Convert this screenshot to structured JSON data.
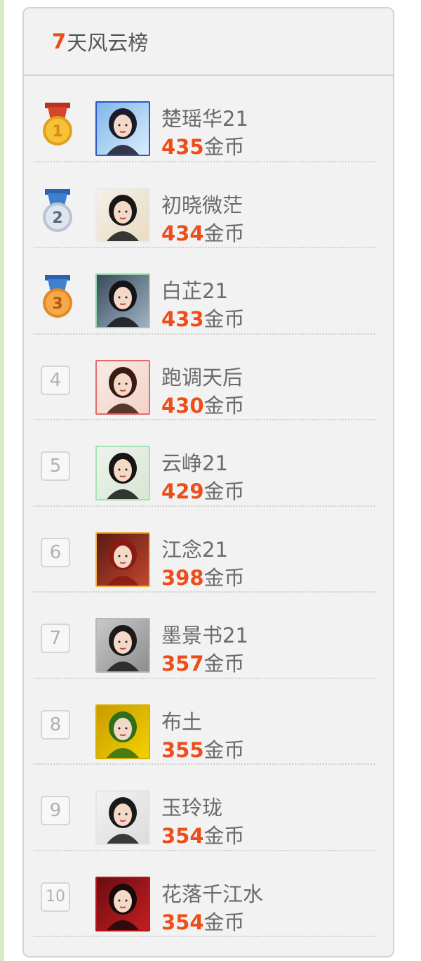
{
  "board": {
    "title_num": "7",
    "title_text": "天风云榜",
    "currency": "金币"
  },
  "ranking": [
    {
      "rank": "1",
      "name": "楚瑶华21",
      "score": "435",
      "badge": "gold-medal-icon",
      "frame": "#2a58c8",
      "bg1": "#7fb6e8",
      "bg2": "#d9eefc",
      "hair": "#1b1b2a"
    },
    {
      "rank": "2",
      "name": "初晓微茫",
      "score": "434",
      "badge": "silver-medal-icon",
      "frame": "#eaeaea",
      "bg1": "#f4efe6",
      "bg2": "#e9dcc4",
      "hair": "#171717"
    },
    {
      "rank": "3",
      "name": "白芷21",
      "score": "433",
      "badge": "bronze-medal-icon",
      "frame": "#8fd6a8",
      "bg1": "#3a4a5c",
      "bg2": "#9fb3c4",
      "hair": "#141416"
    },
    {
      "rank": "4",
      "name": "跑调天后",
      "score": "430",
      "badge": "rank-box",
      "frame": "#e56a6a",
      "bg1": "#f8ece6",
      "bg2": "#f3d2c8",
      "hair": "#3a1a12"
    },
    {
      "rank": "5",
      "name": "云峥21",
      "score": "429",
      "badge": "rank-box",
      "frame": "#a4e3b4",
      "bg1": "#eef3ec",
      "bg2": "#d7e6d2",
      "hair": "#151515"
    },
    {
      "rank": "6",
      "name": "江念21",
      "score": "398",
      "badge": "rank-box",
      "frame": "#f0b24a",
      "bg1": "#5a1a12",
      "bg2": "#c14730",
      "hair": "#8a1a12"
    },
    {
      "rank": "7",
      "name": "墨景书21",
      "score": "357",
      "badge": "rank-box",
      "frame": "#b8b8b8",
      "bg1": "#c9c9c9",
      "bg2": "#8d8d8d",
      "hair": "#1a1a1a"
    },
    {
      "rank": "8",
      "name": "布土",
      "score": "355",
      "badge": "rank-box",
      "frame": "#d6b000",
      "bg1": "#c99a00",
      "bg2": "#f2d200",
      "hair": "#2e6f18"
    },
    {
      "rank": "9",
      "name": "玉玲珑",
      "score": "354",
      "badge": "rank-box",
      "frame": "#e6e6e6",
      "bg1": "#f2f2f2",
      "bg2": "#dcdcdc",
      "hair": "#1a1a1a"
    },
    {
      "rank": "10",
      "name": "花落千江水",
      "score": "354",
      "badge": "rank-box",
      "frame": "#b4161a",
      "bg1": "#6a0d10",
      "bg2": "#c51e22",
      "hair": "#1a0b0b"
    }
  ]
}
